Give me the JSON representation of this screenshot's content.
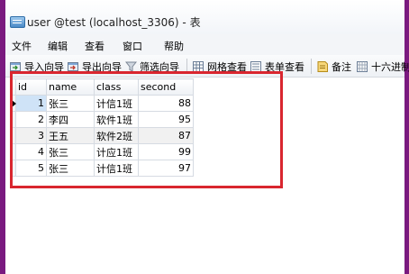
{
  "window": {
    "title": "user @test (localhost_3306) - 表"
  },
  "menu": [
    "文件",
    "编辑",
    "查看",
    "窗口",
    "帮助"
  ],
  "toolbar": {
    "items": [
      {
        "label": "导入向导",
        "icon": "import-wizard-icon"
      },
      {
        "label": "导出向导",
        "icon": "export-wizard-icon"
      },
      {
        "label": "筛选向导",
        "icon": "filter-wizard-icon"
      },
      {
        "label": "网格查看",
        "icon": "grid-view-icon"
      },
      {
        "label": "表单查看",
        "icon": "form-view-icon"
      },
      {
        "label": "备注",
        "icon": "memo-icon"
      },
      {
        "label": "十六进制",
        "icon": "hex-icon"
      }
    ]
  },
  "table": {
    "columns": [
      "id",
      "name",
      "class",
      "second"
    ],
    "rows": [
      [
        "1",
        "张三",
        "计信1班",
        "88"
      ],
      [
        "2",
        "李四",
        "软件1班",
        "95"
      ],
      [
        "3",
        "王五",
        "软件2班",
        "87"
      ],
      [
        "4",
        "张三",
        "计应1班",
        "99"
      ],
      [
        "5",
        "张三",
        "计信1班",
        "97"
      ]
    ],
    "selected_row": 0
  },
  "colors": {
    "frame_border": "#7a1a7f",
    "annotation": "#d9262f",
    "selection": "#cfe3f7"
  }
}
